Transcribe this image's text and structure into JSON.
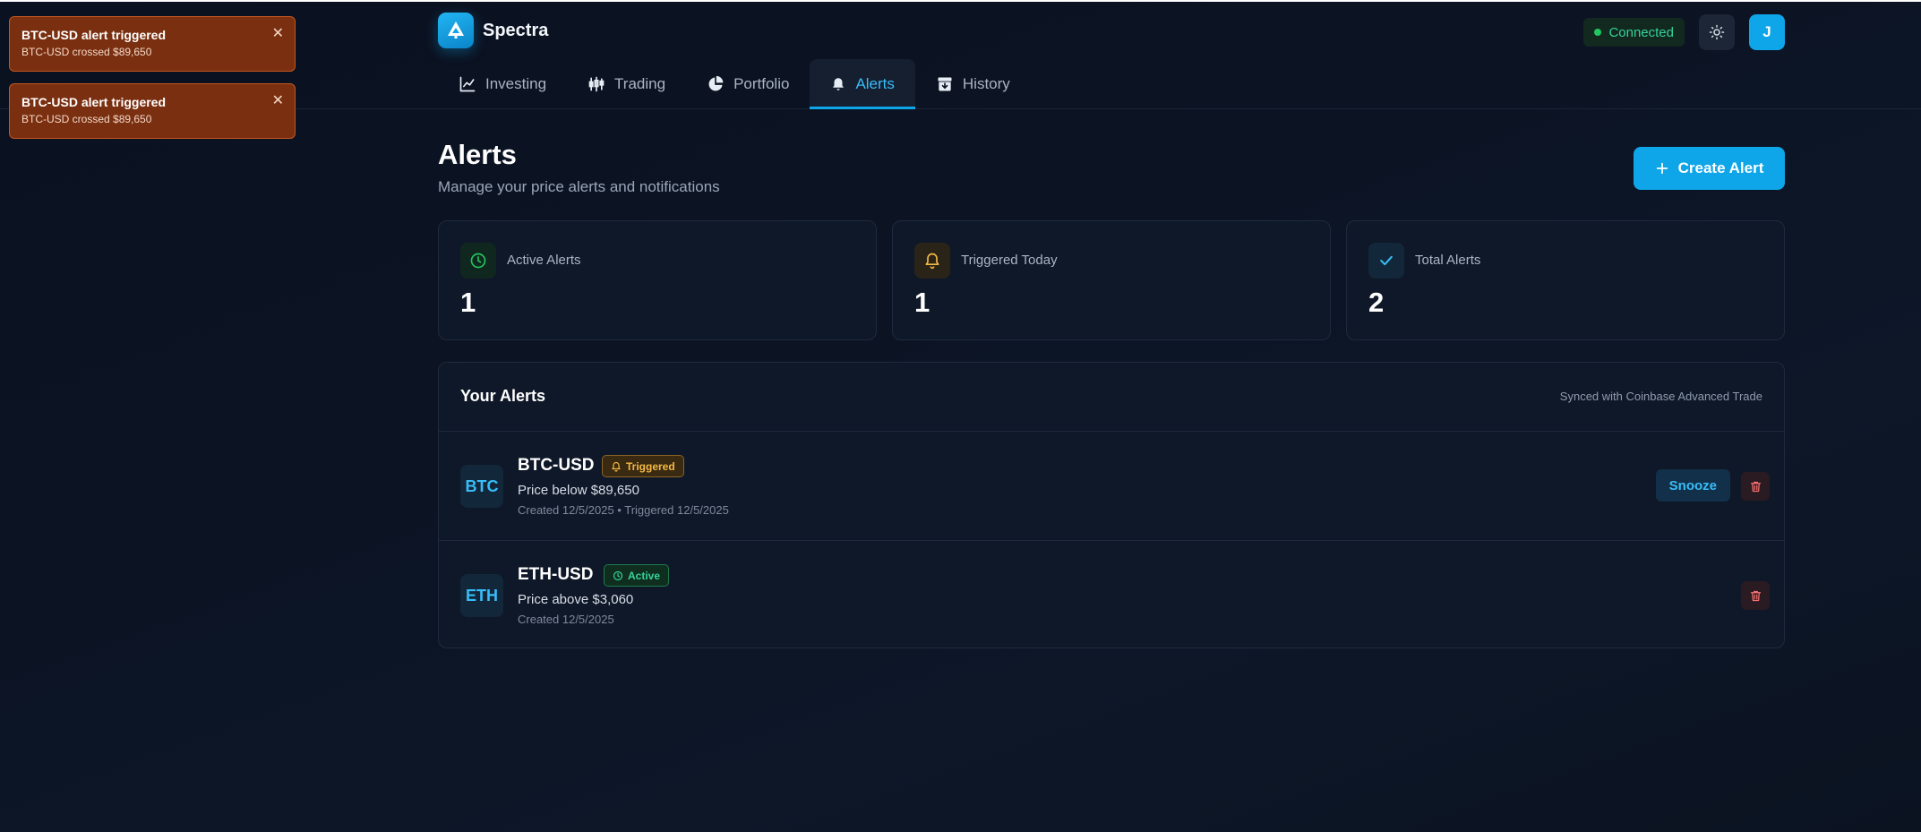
{
  "app": {
    "name": "Spectra",
    "logo_icon": "shield-arrow-logo-icon"
  },
  "header": {
    "status_label": "Connected",
    "status_color": "#22c55e",
    "theme_icon": "sun-icon",
    "avatar_initial": "J"
  },
  "tabs": [
    {
      "label": "Investing",
      "icon": "line-chart-icon"
    },
    {
      "label": "Trading",
      "icon": "candlestick-icon"
    },
    {
      "label": "Portfolio",
      "icon": "pie-chart-icon"
    },
    {
      "label": "Alerts",
      "icon": "bell-icon",
      "active": true
    },
    {
      "label": "History",
      "icon": "archive-icon"
    }
  ],
  "toasts": [
    {
      "title": "BTC-USD alert triggered",
      "body": "BTC-USD crossed $89,650"
    },
    {
      "title": "BTC-USD alert triggered",
      "body": "BTC-USD crossed $89,650"
    }
  ],
  "page": {
    "title": "Alerts",
    "subtitle": "Manage your price alerts and notifications",
    "create_button": "Create Alert"
  },
  "stats": [
    {
      "label": "Active Alerts",
      "value": "1",
      "icon": "clock-icon",
      "color": "#22c55e"
    },
    {
      "label": "Triggered Today",
      "value": "1",
      "icon": "bell-icon",
      "color": "#f5b942"
    },
    {
      "label": "Total Alerts",
      "value": "2",
      "icon": "check-icon",
      "color": "#38bdf8"
    }
  ],
  "alerts_panel": {
    "title": "Your Alerts",
    "sync_text": "Synced with Coinbase Advanced Trade",
    "items": [
      {
        "asset": "BTC",
        "pair": "BTC-USD",
        "status": "Triggered",
        "condition": "Price below $89,650",
        "meta": "Created 12/5/2025 • Triggered 12/5/2025",
        "snooze_label": "Snooze"
      },
      {
        "asset": "ETH",
        "pair": "ETH-USD",
        "status": "Active",
        "condition": "Price above $3,060",
        "meta": "Created 12/5/2025"
      }
    ]
  },
  "colors": {
    "accent": "#0ea5e9",
    "toast_bg": "#7a2f10",
    "danger": "#f87171"
  }
}
